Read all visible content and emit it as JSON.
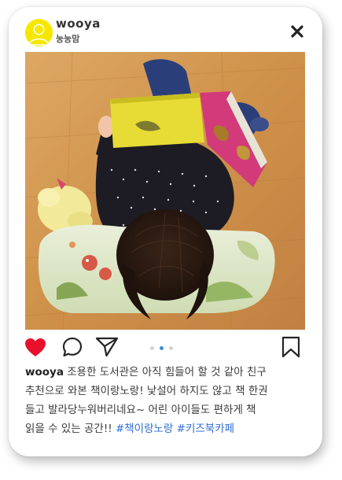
{
  "post": {
    "username": "wooya",
    "subname": "눙눙맘",
    "caption": {
      "user": "wooya",
      "lines": [
        " 조용한 도서관은 아직 힘들어 할 것 같아 친구",
        "추천으로 와본 책이랑노랑!  낯설어 하지도 않고 책 한권",
        "들고 발라당누워버리네요~  어린 아이들도 편하게 책",
        "읽을 수 있는 공간!! "
      ],
      "hashtags": [
        "#책이랑노랑",
        "#키즈북카페"
      ]
    },
    "liked": true,
    "carousel": {
      "count": 3,
      "active_index": 1
    }
  },
  "icons": {
    "close": "close-icon",
    "like": "heart-icon",
    "comment": "comment-icon",
    "share": "paper-plane-icon",
    "save": "bookmark-icon",
    "avatar": "user-avatar-icon"
  },
  "colors": {
    "avatar_bg": "#f6e700",
    "heart": "#e8102b",
    "hashtag": "#2f6fd6",
    "carousel_active": "#3b8fd4"
  }
}
